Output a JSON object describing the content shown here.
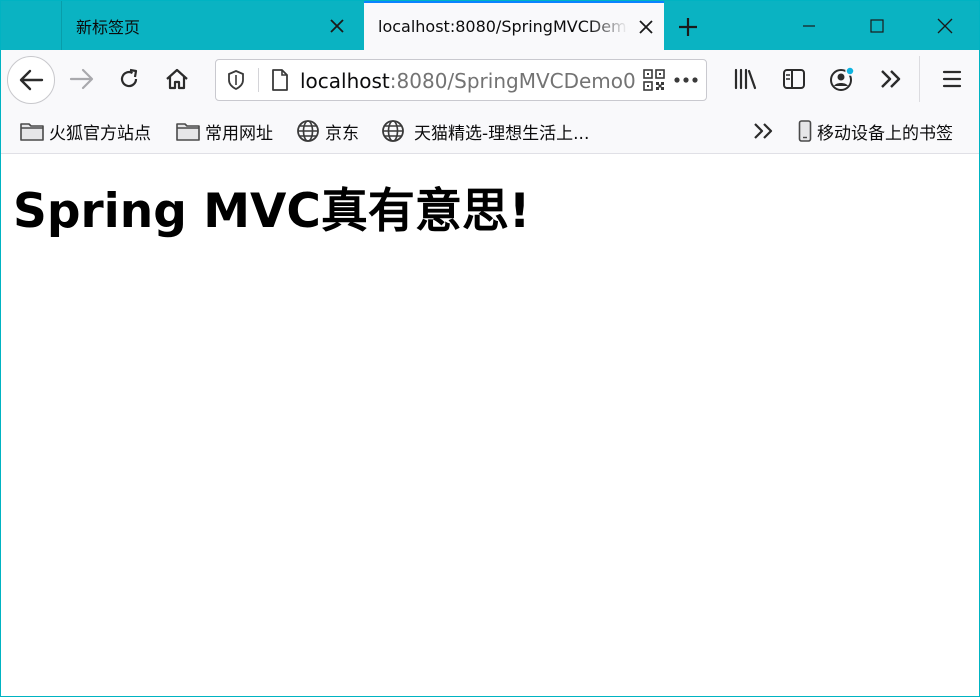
{
  "tabs": [
    {
      "title": "新标签页",
      "active": false
    },
    {
      "title": "localhost:8080/SpringMVCDemo0",
      "active": true
    }
  ],
  "address_bar": {
    "host": "localhost",
    "rest": ":8080/SpringMVCDemo0"
  },
  "bookmarks": {
    "items": [
      {
        "label": "火狐官方站点",
        "icon": "folder-icon"
      },
      {
        "label": "常用网址",
        "icon": "folder-icon"
      },
      {
        "label": "京东",
        "icon": "globe-icon"
      },
      {
        "label": "天猫精选-理想生活上...",
        "icon": "globe-icon"
      }
    ],
    "mobile_label": "移动设备上的书签"
  },
  "page": {
    "heading": "Spring MVC真有意思!"
  },
  "colors": {
    "tabbar": "#0ab3c2",
    "active_tab_accent": "#0a84ff",
    "toolbar": "#f9f9fb"
  }
}
